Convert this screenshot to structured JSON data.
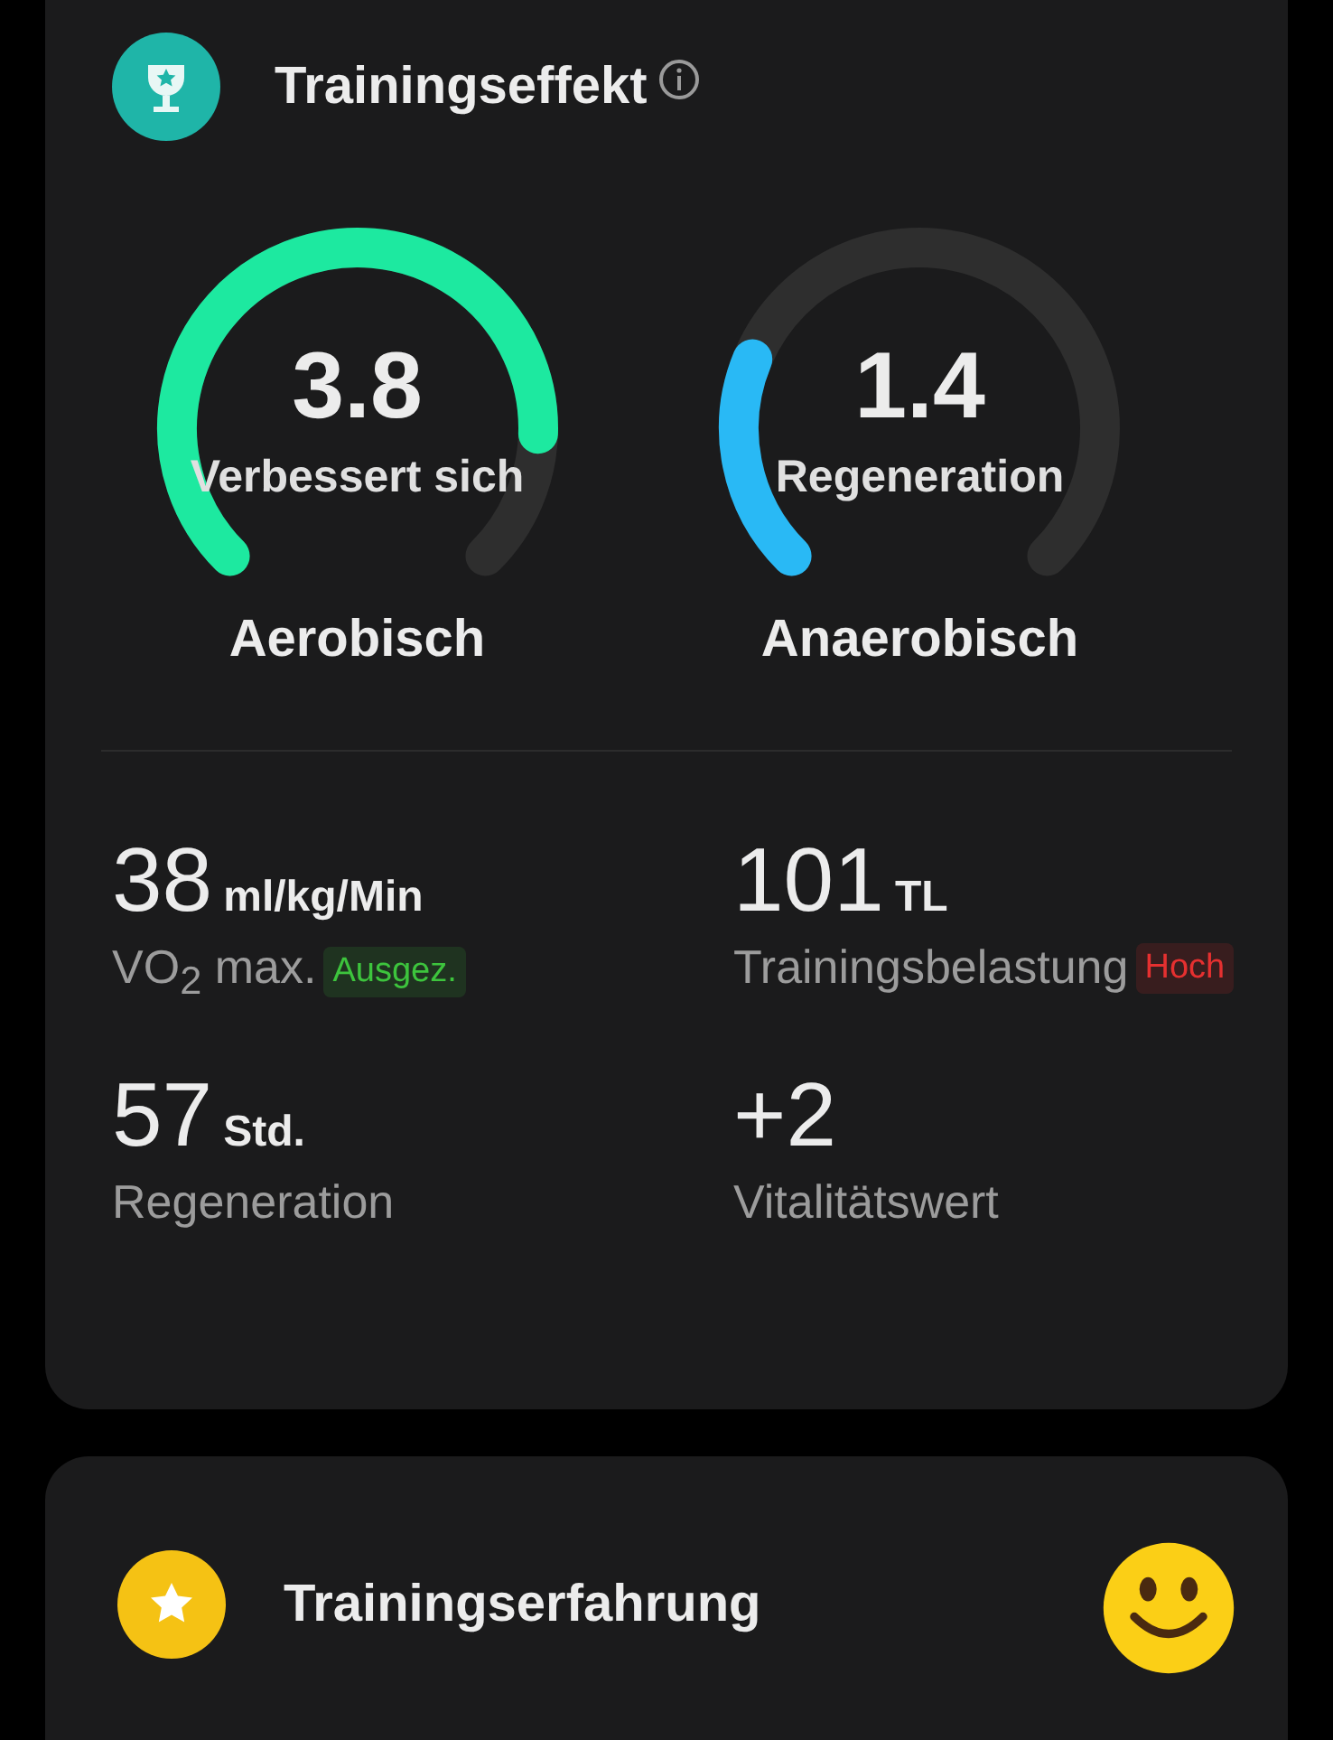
{
  "effect_card": {
    "title": "Trainingseffekt",
    "gauges": [
      {
        "value": "3.8",
        "status": "Verbessert sich",
        "label": "Aerobisch",
        "color": "#1de9a0"
      },
      {
        "value": "1.4",
        "status": "Regeneration",
        "label": "Anaerobisch",
        "color": "#29b9f5"
      }
    ],
    "stats": [
      {
        "value": "38",
        "unit": "ml/kg/Min",
        "label": "VO$_{2}$ max.",
        "badge": {
          "text": "Ausgez.",
          "color": "#3dc43d"
        }
      },
      {
        "value": "101",
        "unit": "TL",
        "label": "Trainingsbelastung",
        "badge": {
          "text": "Hoch",
          "color": "#e53030"
        }
      },
      {
        "value": "57",
        "unit": "Std.",
        "label": "Regeneration"
      },
      {
        "value": "+2",
        "label": "Vitalitätswert"
      }
    ]
  },
  "experience_card": {
    "title": "Trainingserfahrung"
  }
}
